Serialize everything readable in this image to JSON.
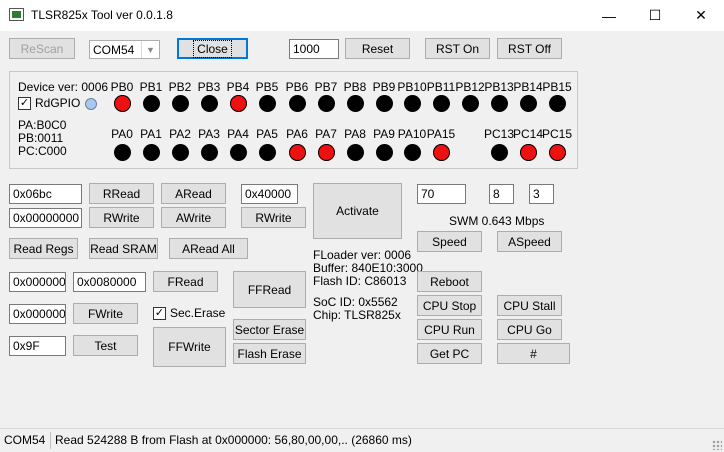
{
  "window": {
    "title": "TLSR825x Tool ver 0.0.1.8",
    "min_glyph": "—",
    "max_glyph": "☐",
    "close_glyph": "✕"
  },
  "toolbar": {
    "rescan": "ReScan",
    "com_port": "COM54",
    "close": "Close",
    "baud": "1000",
    "reset": "Reset",
    "rst_on": "RST On",
    "rst_off": "RST Off"
  },
  "device": {
    "ver": "Device ver: 0006",
    "rdgpio": "RdGPIO",
    "pa": "PA:B0C0",
    "pb": "PB:0011",
    "pc": "PC:C000"
  },
  "gpio": {
    "row1": [
      {
        "label": "PB0",
        "state": "red"
      },
      {
        "label": "PB1",
        "state": "black"
      },
      {
        "label": "PB2",
        "state": "black"
      },
      {
        "label": "PB3",
        "state": "black"
      },
      {
        "label": "PB4",
        "state": "red"
      },
      {
        "label": "PB5",
        "state": "black"
      },
      {
        "label": "PB6",
        "state": "black"
      },
      {
        "label": "PB7",
        "state": "black"
      },
      {
        "label": "PB8",
        "state": "black"
      },
      {
        "label": "PB9",
        "state": "black"
      },
      {
        "label": "PB10",
        "state": "black"
      },
      {
        "label": "PB11",
        "state": "black"
      },
      {
        "label": "PB12",
        "state": "black"
      },
      {
        "label": "PB13",
        "state": "black"
      },
      {
        "label": "PB14",
        "state": "black"
      },
      {
        "label": "PB15",
        "state": "black"
      }
    ],
    "row2": [
      {
        "label": "PA0",
        "state": "black"
      },
      {
        "label": "PA1",
        "state": "black"
      },
      {
        "label": "PA2",
        "state": "black"
      },
      {
        "label": "PA3",
        "state": "black"
      },
      {
        "label": "PA4",
        "state": "black"
      },
      {
        "label": "PA5",
        "state": "black"
      },
      {
        "label": "PA6",
        "state": "red"
      },
      {
        "label": "PA7",
        "state": "red"
      },
      {
        "label": "PA8",
        "state": "black"
      },
      {
        "label": "PA9",
        "state": "black"
      },
      {
        "label": "PA10",
        "state": "black"
      },
      {
        "label": "PA15",
        "state": "red"
      },
      {
        "label": "PC13",
        "state": "black"
      },
      {
        "label": "PC14",
        "state": "red"
      },
      {
        "label": "PC15",
        "state": "red"
      }
    ],
    "colors": {
      "red": "#ee1111",
      "black": "#000000",
      "indicator": "#a9c7f0"
    }
  },
  "ram": {
    "addr": "0x06bc",
    "value": "0x00000000",
    "rread": "RRead",
    "rwrite": "RWrite",
    "aread": "ARead",
    "awrite": "AWrite",
    "aaddr": "0x40000",
    "rwrite2": "RWrite",
    "read_regs": "Read Regs",
    "read_sram": "Read SRAM",
    "aread_all": "ARead All"
  },
  "activate": "Activate",
  "info": {
    "floader": "FLoader ver: 0006",
    "buffer": "Buffer: 840E10:3000",
    "flash_id": "Flash ID: C86013",
    "soc_id": "SoC ID: 0x5562",
    "chip": "Chip: TLSR825x"
  },
  "flash": {
    "addr": "0x000000",
    "size": "0x0080000",
    "fread": "FRead",
    "ffread": "FFRead",
    "waddr": "0x000000",
    "fwrite": "FWrite",
    "sec_erase": "Sec.Erase",
    "sector_erase": "Sector Erase",
    "test_val": "0x9F",
    "test": "Test",
    "ffwrite": "FFWrite",
    "flash_erase": "Flash Erase"
  },
  "swm": {
    "val1": "70",
    "val2": "8",
    "val3": "3",
    "speed_label": "SWM 0.643 Mbps",
    "speed": "Speed",
    "aspeed": "ASpeed"
  },
  "cpu": {
    "reboot": "Reboot",
    "stop": "CPU Stop",
    "stall": "CPU Stall",
    "run": "CPU Run",
    "go": "CPU Go",
    "get_pc": "Get PC",
    "hash": "#"
  },
  "status": {
    "port": "COM54",
    "message": "Read 524288 B from Flash at 0x000000: 56,80,00,00,.. (26860 ms)"
  }
}
